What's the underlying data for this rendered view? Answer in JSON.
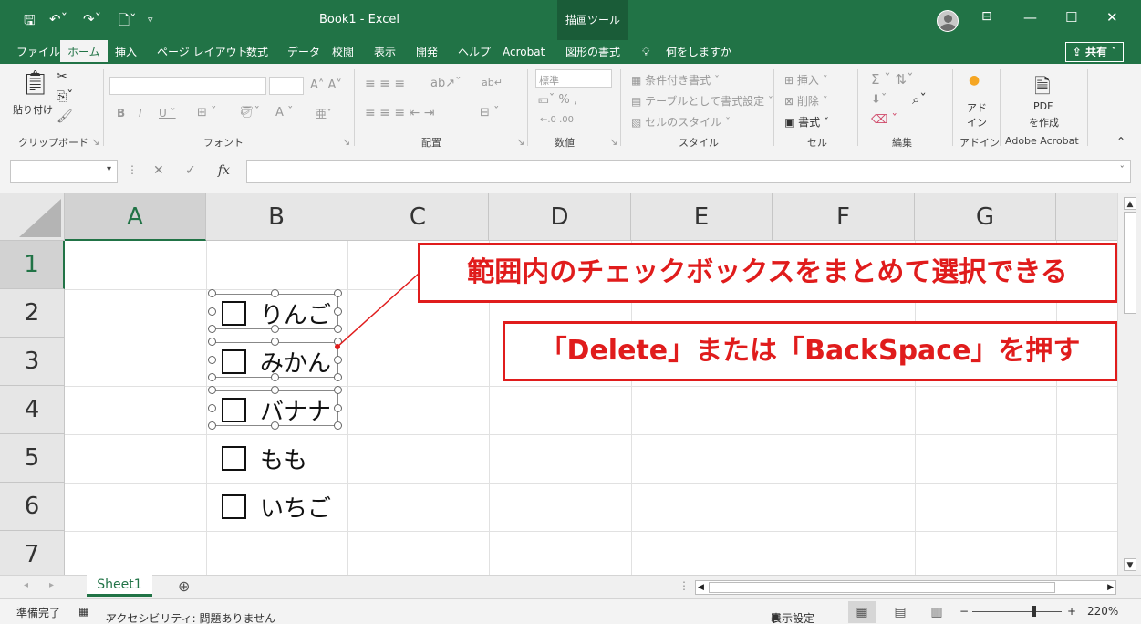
{
  "title_bar": {
    "save_icon": "save-icon",
    "undo_icon": "undo-icon",
    "redo_icon": "redo-icon",
    "doc_title": "Book1  -  Excel",
    "context_tab": "描画ツール",
    "minimize": "—",
    "restore": "☐",
    "close": "✕"
  },
  "tabs": {
    "file": "ファイル",
    "home": "ホーム",
    "insert": "挿入",
    "page_layout": "ページ レイアウト",
    "formulas": "数式",
    "data": "データ",
    "review": "校閲",
    "view": "表示",
    "developer": "開発",
    "help": "ヘルプ",
    "acrobat": "Acrobat",
    "shape_format": "図形の書式",
    "tell_me": "何をしますか",
    "share": "共有"
  },
  "ribbon": {
    "paste": "貼り付け",
    "groups": {
      "clipboard": "クリップボード",
      "font": "フォント",
      "alignment": "配置",
      "number": "数値",
      "styles": "スタイル",
      "cells": "セル",
      "editing": "編集",
      "addins": "アドイン",
      "adobe_acrobat": "Adobe Acrobat"
    },
    "number_format": "標準",
    "conditional_formatting": "条件付き書式",
    "format_as_table": "テーブルとして書式設定",
    "cell_styles": "セルのスタイル",
    "insert": "挿入",
    "delete": "削除",
    "format": "書式",
    "addins_line1": "アド",
    "addins_line2": "イン",
    "pdf_line1": "PDF",
    "pdf_line2": "を作成"
  },
  "formula_bar": {
    "name_box": "",
    "fx": "fx",
    "content": ""
  },
  "columns": [
    "A",
    "B",
    "C",
    "D",
    "E",
    "F",
    "G"
  ],
  "rows": [
    "1",
    "2",
    "3",
    "4",
    "5",
    "6",
    "7"
  ],
  "checkboxes": [
    {
      "label": "りんご",
      "selected": true
    },
    {
      "label": "みかん",
      "selected": true
    },
    {
      "label": "バナナ",
      "selected": true
    },
    {
      "label": "もも",
      "selected": false
    },
    {
      "label": "いちご",
      "selected": false
    }
  ],
  "callouts": {
    "top": "範囲内のチェックボックスをまとめて選択できる",
    "bottom": "「Delete」または「BackSpace」を押す"
  },
  "sheet_tabs": {
    "active": "Sheet1",
    "add": "⊕"
  },
  "status_bar": {
    "ready": "準備完了",
    "accessibility": "アクセシビリティ: 問題ありません",
    "display_settings": "表示設定",
    "zoom": "220%"
  },
  "colors": {
    "excel_green": "#217346",
    "callout_red": "#e01c1c"
  }
}
